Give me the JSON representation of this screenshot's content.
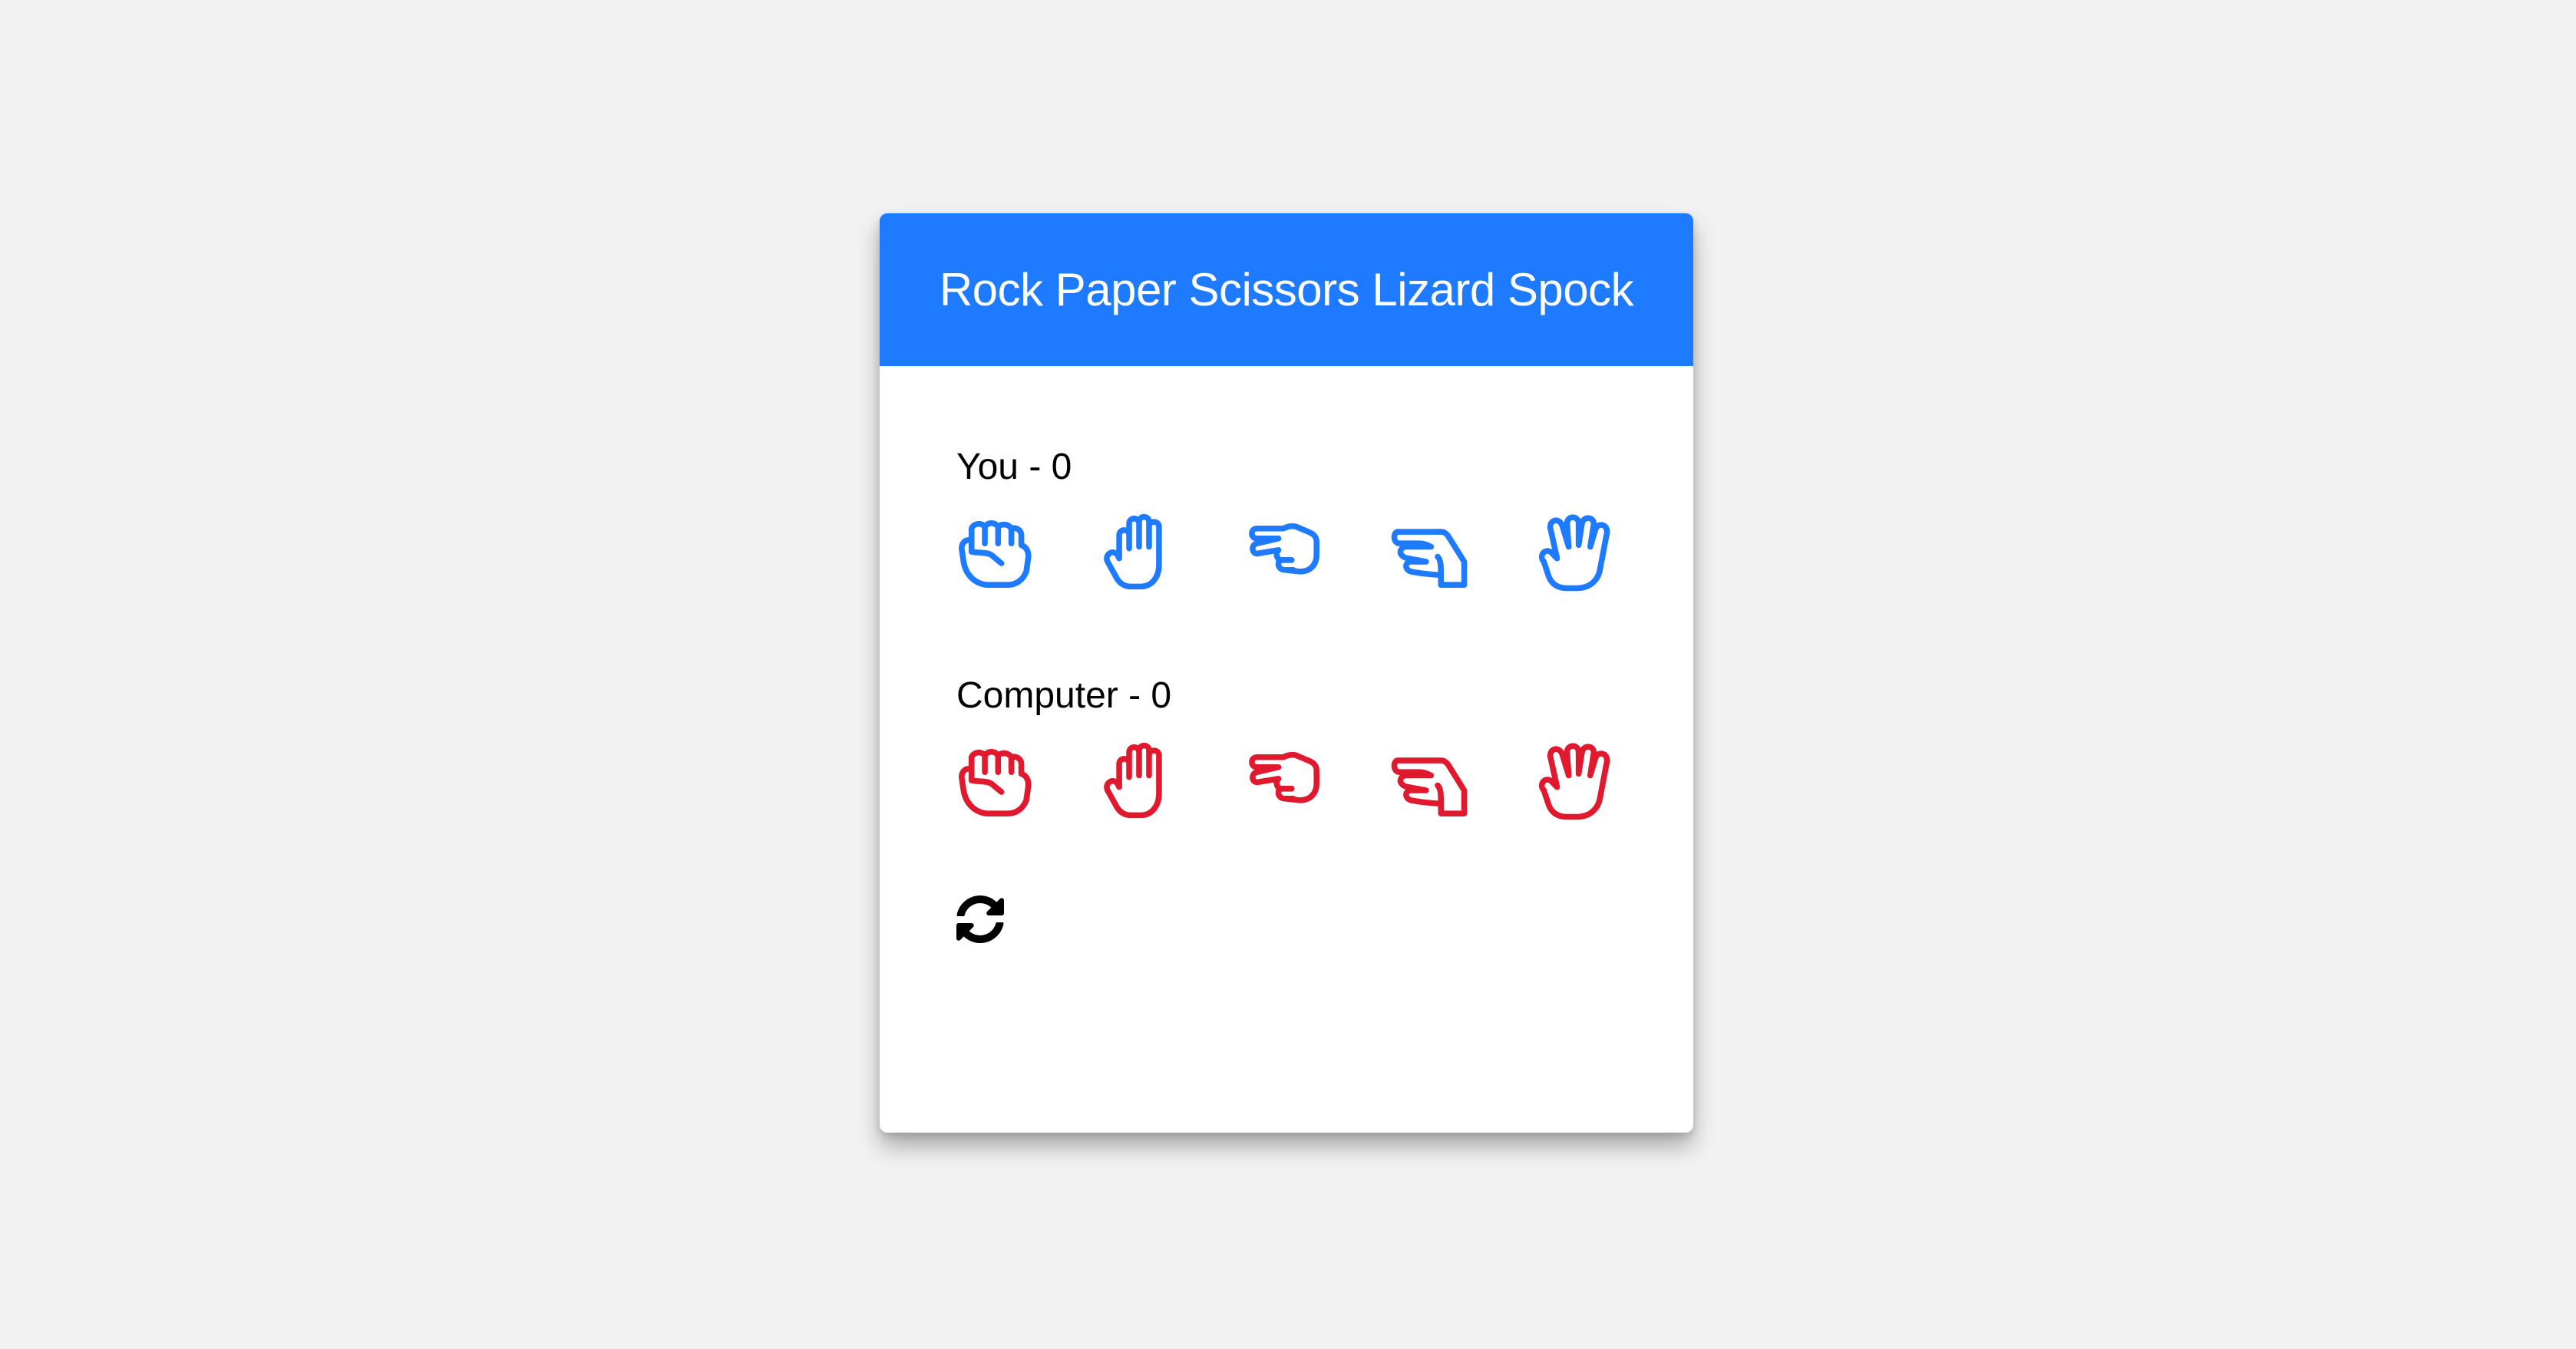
{
  "app": {
    "title": "Rock Paper Scissors Lizard Spock",
    "accent_color": "#1e7bff",
    "player_color": "#1e7bff",
    "computer_color": "#e0192e"
  },
  "player": {
    "label": "You - 0",
    "hands": [
      {
        "name": "rock",
        "icon": "hand-rock-icon"
      },
      {
        "name": "paper",
        "icon": "hand-paper-icon"
      },
      {
        "name": "scissors",
        "icon": "hand-scissors-icon"
      },
      {
        "name": "lizard",
        "icon": "hand-lizard-icon"
      },
      {
        "name": "spock",
        "icon": "hand-spock-icon"
      }
    ]
  },
  "computer": {
    "label": "Computer - 0",
    "hands": [
      {
        "name": "rock",
        "icon": "hand-rock-icon"
      },
      {
        "name": "paper",
        "icon": "hand-paper-icon"
      },
      {
        "name": "scissors",
        "icon": "hand-scissors-icon"
      },
      {
        "name": "lizard",
        "icon": "hand-lizard-icon"
      },
      {
        "name": "spock",
        "icon": "hand-spock-icon"
      }
    ]
  },
  "reset": {
    "icon": "refresh-icon"
  }
}
